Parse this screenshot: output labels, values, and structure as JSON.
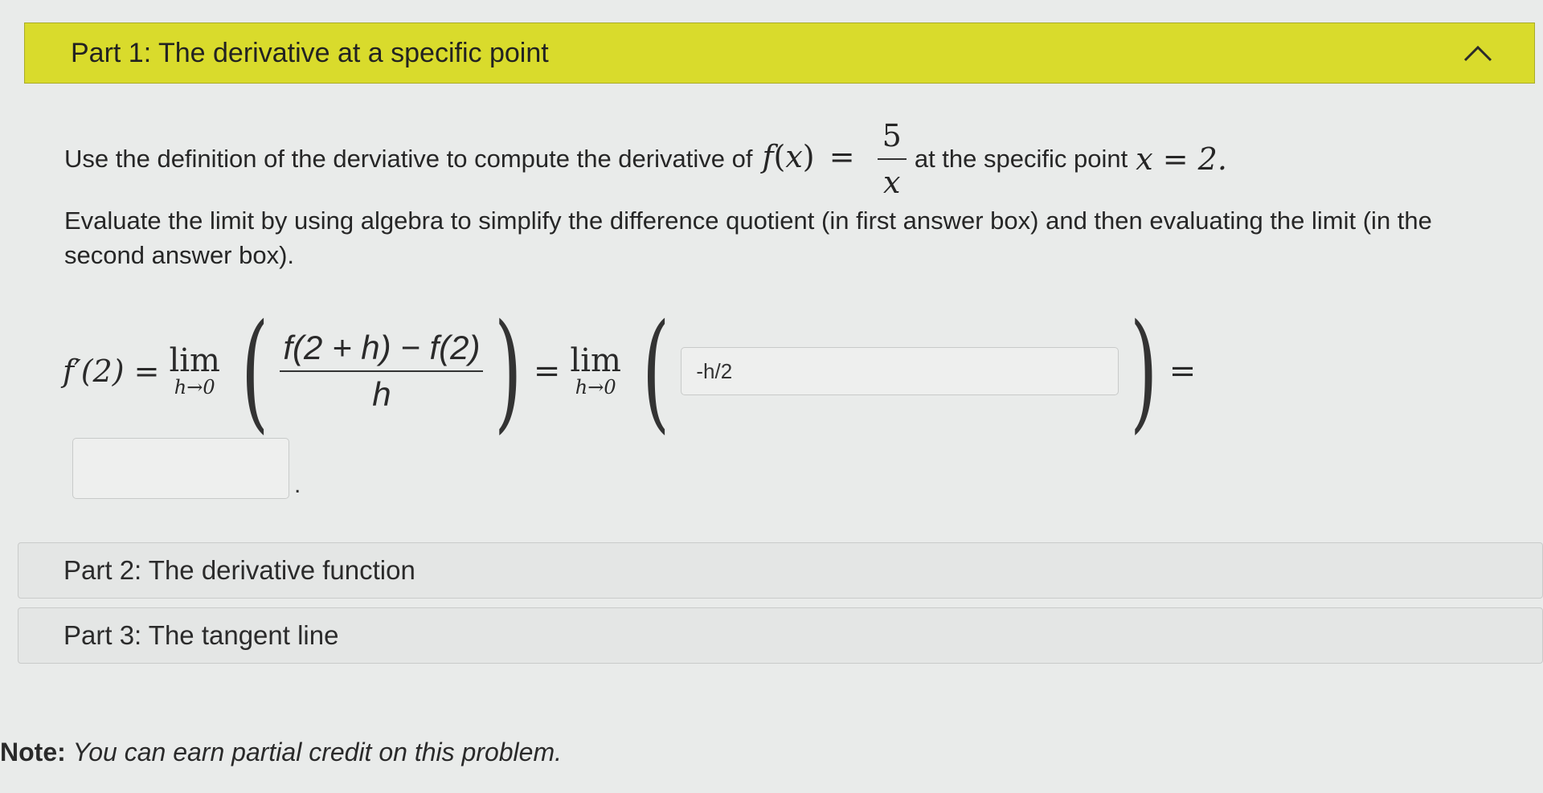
{
  "part1": {
    "title": "Part 1: The derivative at a specific point",
    "expand_icon": "chevron-up-icon"
  },
  "problem": {
    "intro": "Use the definition of the derviative to compute the derivative of",
    "func": "f",
    "var": "x",
    "numerator": "5",
    "denominator": "x",
    "at_text": "at the specific point",
    "point": "x = 2.",
    "instructions": "Evaluate the limit by using algebra to simplify the difference quotient (in first answer box) and then evaluating the limit (in the second answer box)."
  },
  "equation": {
    "lhs": "f′(2) =",
    "lim_word": "lim",
    "lim_sub": "h→0",
    "dq_num": "f(2 + h) − f(2)",
    "dq_den": "h",
    "eq1": "=",
    "eq2": "=",
    "open_paren": "(",
    "close_paren": ")"
  },
  "answers": {
    "answer1_value": "-h/2",
    "answer2_value": "",
    "period": "."
  },
  "part2": {
    "title": "Part 2: The derivative function"
  },
  "part3": {
    "title": "Part 3: The tangent line"
  },
  "note": {
    "label": "Note:",
    "text": "You can earn partial credit on this problem."
  }
}
